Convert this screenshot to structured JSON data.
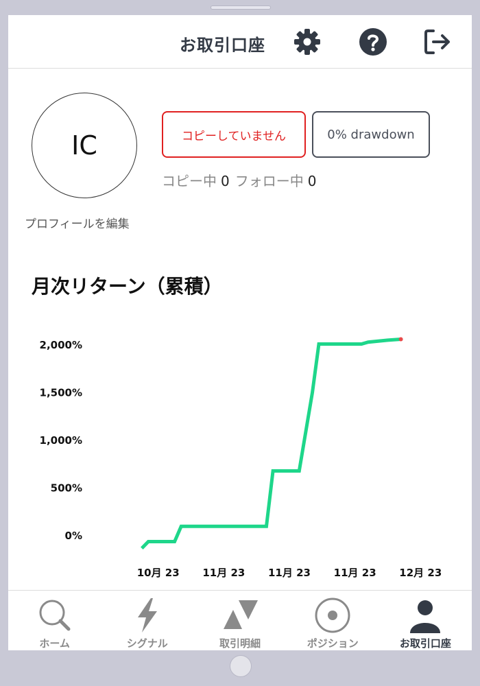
{
  "header": {
    "title": "お取引口座",
    "icons": [
      "gear-icon",
      "help-icon",
      "logout-icon"
    ]
  },
  "profile": {
    "initials": "IC",
    "edit_label": "プロフィールを編集",
    "status_button": "コピーしていません",
    "drawdown_button": "0% drawdown",
    "copying_label": "コピー中",
    "copying_count": "0",
    "following_label": "フォロー中",
    "following_count": "0"
  },
  "chart_title": "月次リターン（累積）",
  "chart_data": {
    "type": "line",
    "title": "月次リターン（累積）",
    "ylabel": "",
    "xlabel": "",
    "y_ticks": [
      "2,000%",
      "1,500%",
      "1,000%",
      "500%",
      "0%"
    ],
    "y_tick_values": [
      2000,
      1500,
      1000,
      500,
      0
    ],
    "x_ticks": [
      "10月 23",
      "11月 23",
      "11月 23",
      "11月 23",
      "12月 23"
    ],
    "x_tick_values": [
      0,
      1,
      2,
      3,
      4
    ],
    "ylim": [
      -150,
      2150
    ],
    "xlim": [
      -0.3,
      4.3
    ],
    "series": [
      {
        "color": "#1ed68a",
        "points": [
          [
            -0.25,
            -130
          ],
          [
            -0.15,
            -60
          ],
          [
            0.25,
            -60
          ],
          [
            0.35,
            100
          ],
          [
            1.55,
            100
          ],
          [
            1.65,
            100
          ],
          [
            1.75,
            680
          ],
          [
            2.15,
            680
          ],
          [
            2.35,
            1500
          ],
          [
            2.45,
            2010
          ],
          [
            3.1,
            2010
          ],
          [
            3.2,
            2030
          ],
          [
            3.5,
            2050
          ],
          [
            3.7,
            2060
          ]
        ]
      }
    ],
    "end_marker_color": "#e84a4a",
    "grid": false
  },
  "tabs": [
    {
      "label": "ホーム",
      "icon": "search-icon",
      "active": false
    },
    {
      "label": "シグナル",
      "icon": "lightning-icon",
      "active": false
    },
    {
      "label": "取引明細",
      "icon": "triangles-icon",
      "active": false
    },
    {
      "label": "ポジション",
      "icon": "target-icon",
      "active": false
    },
    {
      "label": "お取引口座",
      "icon": "user-icon",
      "active": true
    }
  ]
}
